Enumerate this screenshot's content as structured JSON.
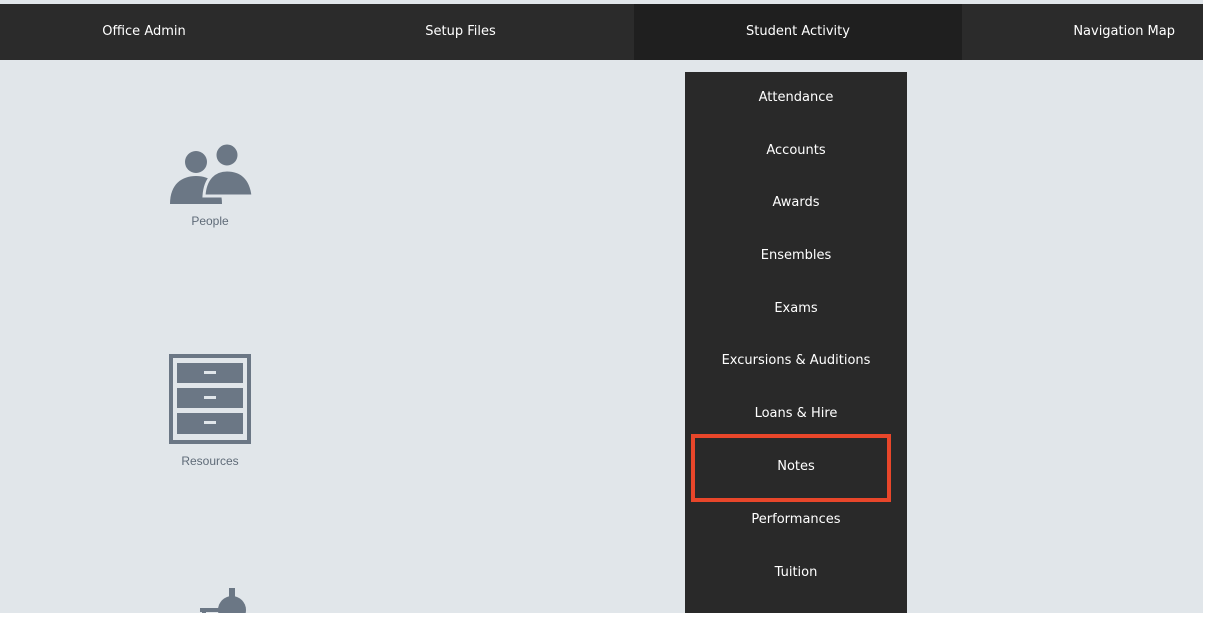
{
  "nav": {
    "items": [
      {
        "label": "Office Admin"
      },
      {
        "label": "Setup Files"
      },
      {
        "label": "Student Activity"
      },
      {
        "label": "Navigation Map"
      }
    ]
  },
  "dropdown": {
    "items": [
      {
        "label": "Attendance"
      },
      {
        "label": "Accounts"
      },
      {
        "label": "Awards"
      },
      {
        "label": "Ensembles"
      },
      {
        "label": "Exams"
      },
      {
        "label": "Excursions & Auditions"
      },
      {
        "label": "Loans & Hire"
      },
      {
        "label": "Notes"
      },
      {
        "label": "Performances"
      },
      {
        "label": "Tuition"
      }
    ],
    "highlighted": "Notes"
  },
  "tiles": {
    "people": {
      "label": "People",
      "icon": "people-icon"
    },
    "resources": {
      "label": "Resources",
      "icon": "filing-cabinet-icon"
    },
    "finance": {
      "icon": "money-icon"
    }
  },
  "colors": {
    "nav_bg": "#2b2b2b",
    "nav_active_bg": "#1f1f1f",
    "dropdown_bg": "#292929",
    "content_bg": "#e1e6ea",
    "icon": "#6b7785",
    "highlight": "#e8462a"
  }
}
